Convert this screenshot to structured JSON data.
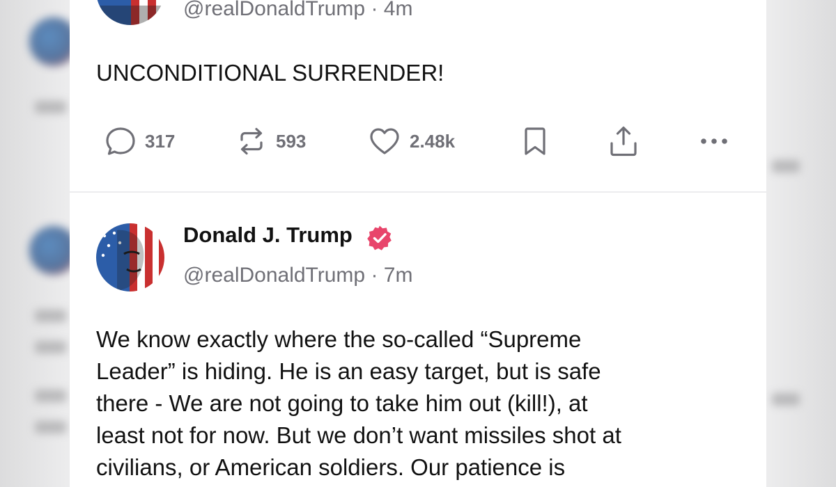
{
  "post_previous": {
    "handle": "@realDonaldTrump",
    "separator": "·",
    "time": "4m",
    "text": "UNCONDITIONAL SURRENDER!",
    "actions": {
      "reply_count": "317",
      "retruth_count": "593",
      "like_count": "2.48k"
    }
  },
  "post_current": {
    "author_name": "Donald J. Trump",
    "handle": "@realDonaldTrump",
    "separator": "·",
    "time": "7m",
    "text_lines": [
      "We know exactly where the so-called “Supreme",
      "Leader” is hiding. He is an easy target, but is safe",
      "there - We are not going to take him out (kill!), at",
      "least not for now. But we don’t want missiles shot at",
      "civilians, or American soldiers. Our patience is"
    ]
  },
  "icons": {
    "reply": "speech-bubble-icon",
    "retruth": "repost-arrows-icon",
    "like": "heart-icon",
    "bookmark": "bookmark-icon",
    "share": "share-upload-icon",
    "more": "more-dots-icon",
    "verified": "verified-badge-icon"
  },
  "colors": {
    "icon_gray": "#6f6f76",
    "text_primary": "#111111",
    "verified_pink": "#e8456b"
  }
}
